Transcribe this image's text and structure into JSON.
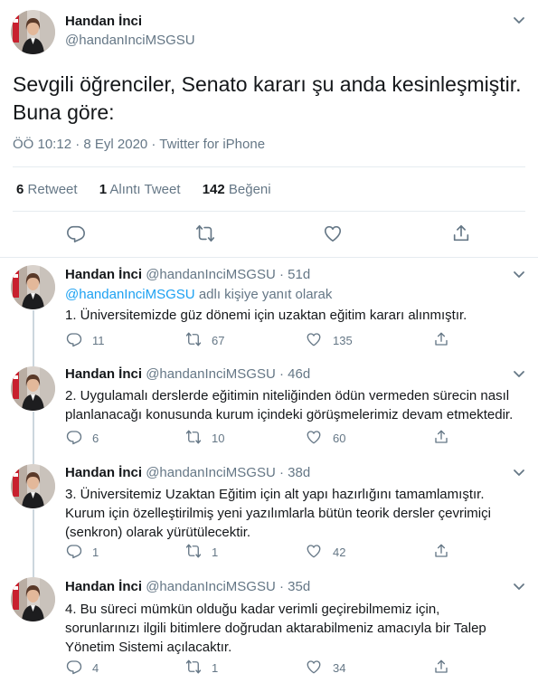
{
  "main_tweet": {
    "author_name": "Handan İnci",
    "handle": "@handanInciMSGSU",
    "text": "Sevgili öğrenciler, Senato kararı şu anda kesinleşmiştir. Buna göre:",
    "meta": "ÖÖ 10:12 · 8 Eyl 2020 · Twitter for iPhone",
    "stats": {
      "retweets_count": "6",
      "retweets_label": "Retweet",
      "quotes_count": "1",
      "quotes_label": "Alıntı Tweet",
      "likes_count": "142",
      "likes_label": "Beğeni"
    },
    "actions": [
      "reply-icon",
      "retweet-icon",
      "like-icon",
      "share-icon"
    ]
  },
  "replies": [
    {
      "author_name": "Handan İnci",
      "handle_time": "@handanInciMSGSU · 51d",
      "reply_to_handle": "@handanInciMSGSU",
      "reply_to_suffix": "adlı kişiye yanıt olarak",
      "text": "1. Üniversitemizde güz dönemi için uzaktan eğitim kararı alınmıştır.",
      "replies": "11",
      "retweets": "67",
      "likes": "135"
    },
    {
      "author_name": "Handan İnci",
      "handle_time": "@handanInciMSGSU · 46d",
      "text": "2. Uygulamalı derslerde eğitimin niteliğinden ödün vermeden sürecin nasıl planlanacağı konusunda kurum içindeki görüşmelerimiz devam etmektedir.",
      "replies": "6",
      "retweets": "10",
      "likes": "60"
    },
    {
      "author_name": "Handan İnci",
      "handle_time": "@handanInciMSGSU · 38d",
      "text": "3. Üniversitemiz Uzaktan Eğitim için alt yapı hazırlığını tamamlamıştır. Kurum için özelleştirilmiş yeni yazılımlarla bütün teorik dersler çevrimiçi (senkron) olarak yürütülecektir.",
      "replies": "1",
      "retweets": "1",
      "likes": "42"
    },
    {
      "author_name": "Handan İnci",
      "handle_time": "@handanInciMSGSU · 35d",
      "text": "4. Bu süreci mümkün olduğu kadar verimli geçirebilmemiz için, sorunlarınızı ilgili bitimlere doğrudan aktarabilmeniz amacıyla bir Talep Yönetim Sistemi açılacaktır.",
      "replies": "4",
      "retweets": "1",
      "likes": "34"
    }
  ],
  "colors": {
    "text": "#14171a",
    "secondary": "#657786",
    "link": "#1da1f2",
    "divider": "#e6ecf0",
    "thread_line": "#ccd6dd"
  }
}
